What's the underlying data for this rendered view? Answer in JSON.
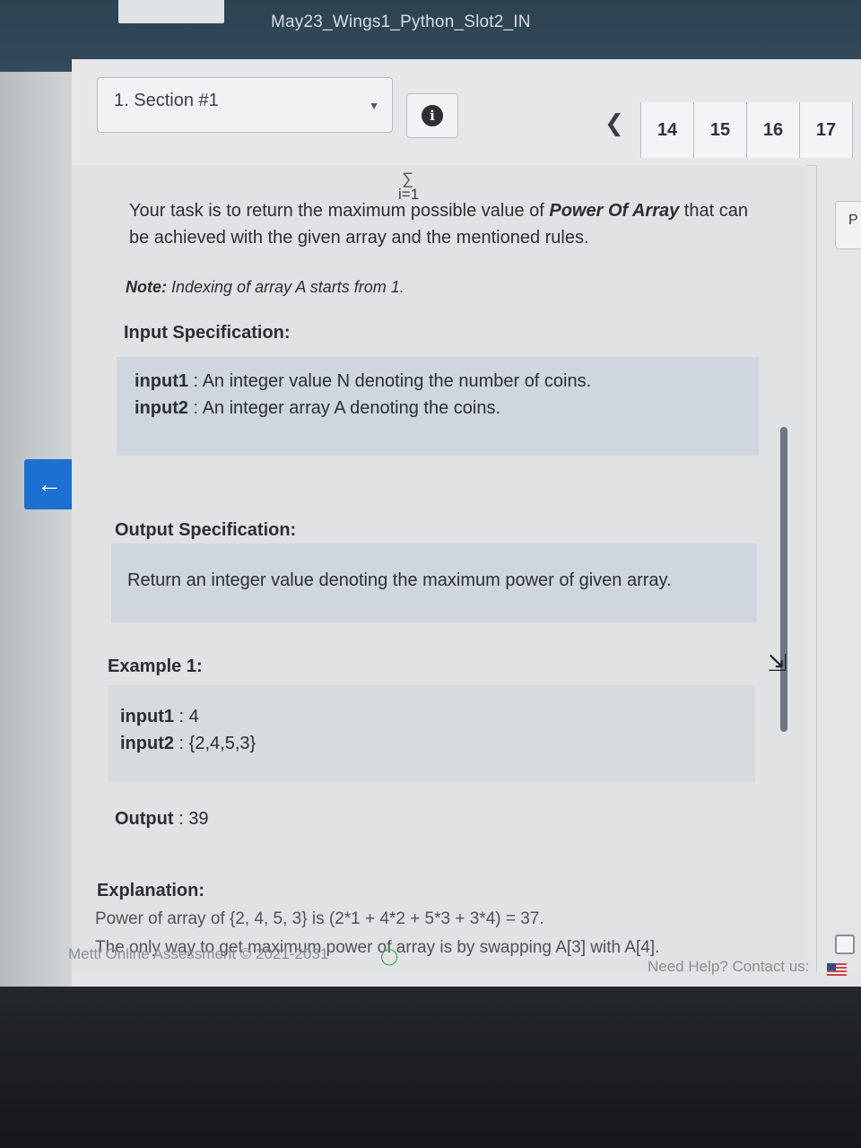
{
  "window": {
    "test_title": "May23_Wings1_Python_Slot2_IN"
  },
  "header": {
    "section_select": "1. Section #1",
    "question_numbers": [
      "14",
      "15",
      "16",
      "17"
    ]
  },
  "problem": {
    "formula_fragment": "i=1",
    "task_prefix": "Your task is to return the maximum possible value of ",
    "task_bold": "Power Of Array",
    "task_suffix": " that can be achieved with the given array and the mentioned rules.",
    "note_label": "Note:",
    "note_text": " Indexing of array A starts from 1.",
    "input_heading": "Input Specification:",
    "input1_label": "input1",
    "input1_text": " : An integer value N denoting the number of coins.",
    "input2_label": "input2",
    "input2_text": " : An integer array A  denoting the coins.",
    "output_heading": "Output Specification:",
    "output_text": "Return an integer value denoting the maximum power of given array.",
    "example_heading": "Example 1:",
    "example_input1_label": "input1",
    "example_input1_value": " : 4",
    "example_input2_label": "input2",
    "example_input2_value": " : {2,4,5,3}",
    "example_output_label": "Output",
    "example_output_value": " : 39",
    "explanation_heading": "Explanation:",
    "explanation_line1": "Power of array of {2, 4, 5, 3} is (2*1 + 4*2 + 5*3 + 3*4) = 37.",
    "explanation_line2": "The only way to get maximum power of array is by swapping A[3] with A[4]."
  },
  "right_panel": {
    "box_text": "P"
  },
  "footer": {
    "copyright": "Mettl Online Assessment © 2021-2031",
    "help": "Need Help? Contact us:"
  }
}
